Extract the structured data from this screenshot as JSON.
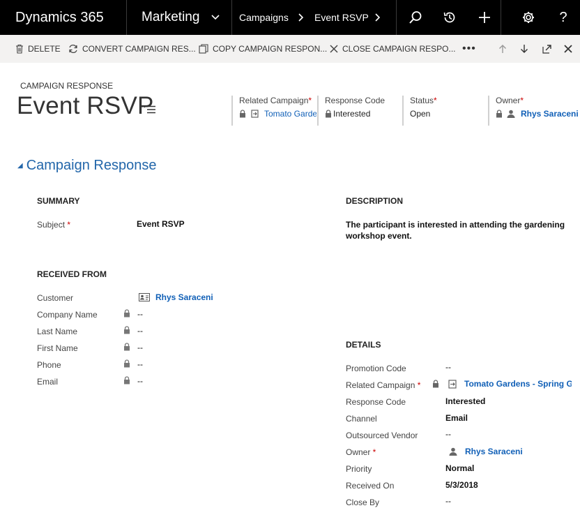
{
  "topnav": {
    "brand": "Dynamics 365",
    "app": "Marketing",
    "breadcrumb": [
      "Campaigns",
      "Event RSVP"
    ]
  },
  "commandbar": {
    "delete": "DELETE",
    "convert": "CONVERT CAMPAIGN RES...",
    "copy": "COPY CAMPAIGN RESPON...",
    "close": "CLOSE CAMPAIGN RESPO...",
    "more": "•••"
  },
  "header": {
    "entity_label": "CAMPAIGN RESPONSE",
    "title": "Event RSVP",
    "fields": {
      "related_campaign": {
        "label": "Related Campaign",
        "value": "Tomato Gardens - Spring Gardening Workshop"
      },
      "response_code": {
        "label": "Response Code",
        "value": "Interested"
      },
      "status": {
        "label": "Status",
        "value": "Open"
      },
      "owner": {
        "label": "Owner",
        "value": "Rhys Saraceni"
      }
    }
  },
  "section": {
    "title": "Campaign Response",
    "summary": {
      "heading": "SUMMARY",
      "subject_label": "Subject",
      "subject_value": "Event RSVP"
    },
    "description": {
      "heading": "DESCRIPTION",
      "text": "The participant is interested in attending the gardening workshop event."
    },
    "received_from": {
      "heading": "RECEIVED FROM",
      "customer_label": "Customer",
      "customer_value": "Rhys Saraceni",
      "rows": [
        {
          "label": "Company Name",
          "value": "--"
        },
        {
          "label": "Last Name",
          "value": "--"
        },
        {
          "label": "First Name",
          "value": "--"
        },
        {
          "label": "Phone",
          "value": "--"
        },
        {
          "label": "Email",
          "value": "--"
        }
      ]
    },
    "details": {
      "heading": "DETAILS",
      "promotion_code": {
        "label": "Promotion Code",
        "value": "--"
      },
      "related_campaign": {
        "label": "Related Campaign",
        "value": "Tomato Gardens - Spring Gardening Workshop"
      },
      "response_code": {
        "label": "Response Code",
        "value": "Interested"
      },
      "channel": {
        "label": "Channel",
        "value": "Email"
      },
      "outsourced_vendor": {
        "label": "Outsourced Vendor",
        "value": "--"
      },
      "owner": {
        "label": "Owner",
        "value": "Rhys Saraceni"
      },
      "priority": {
        "label": "Priority",
        "value": "Normal"
      },
      "received_on": {
        "label": "Received On",
        "value": "5/3/2018"
      },
      "close_by": {
        "label": "Close By",
        "value": "--"
      }
    }
  },
  "colors": {
    "nav_bg": "#000000",
    "cmdbar_bg": "#f3f2f1",
    "link": "#1160b7",
    "section_title": "#2266aa",
    "required": "#cc0000"
  }
}
